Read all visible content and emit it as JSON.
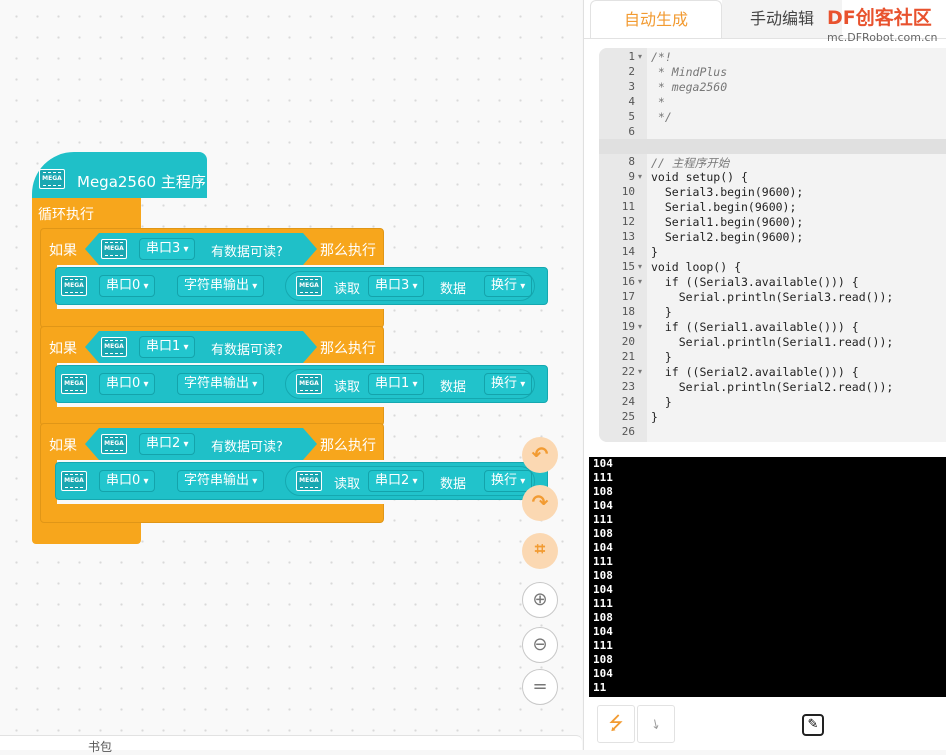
{
  "blocks": {
    "main_hat": "Mega2560 主程序",
    "loop_label": "循环执行",
    "mega_chip": "MEGA",
    "ifs": [
      {
        "if_label": "如果",
        "port": "串口3",
        "available": "有数据可读?",
        "then": "那么执行",
        "cmd_port": "串口0",
        "output_mode": "字符串输出",
        "read_label": "读取",
        "read_port": "串口3",
        "data_label": "数据",
        "newline": "换行"
      },
      {
        "if_label": "如果",
        "port": "串口1",
        "available": "有数据可读?",
        "then": "那么执行",
        "cmd_port": "串口0",
        "output_mode": "字符串输出",
        "read_label": "读取",
        "read_port": "串口1",
        "data_label": "数据",
        "newline": "换行"
      },
      {
        "if_label": "如果",
        "port": "串口2",
        "available": "有数据可读?",
        "then": "那么执行",
        "cmd_port": "串口0",
        "output_mode": "字符串输出",
        "read_label": "读取",
        "read_port": "串口2",
        "data_label": "数据",
        "newline": "换行"
      }
    ]
  },
  "backpack_label": "书包",
  "tabs": {
    "auto": "自动生成",
    "manual": "手动编辑"
  },
  "watermark": {
    "brand": "DF创客社区",
    "url": "mc.DFRobot.com.cn"
  },
  "code": {
    "line_numbers": [
      "1",
      "2",
      "3",
      "4",
      "5",
      "6",
      "7",
      "8",
      "9",
      "10",
      "11",
      "12",
      "13",
      "14",
      "15",
      "16",
      "17",
      "18",
      "19",
      "20",
      "21",
      "22",
      "23",
      "24",
      "25",
      "26"
    ],
    "lines": [
      "/*!",
      " * MindPlus",
      " * mega2560",
      " *",
      " */",
      "",
      "",
      "// 主程序开始",
      "void setup() {",
      "  Serial3.begin(9600);",
      "  Serial.begin(9600);",
      "  Serial1.begin(9600);",
      "  Serial2.begin(9600);",
      "}",
      "void loop() {",
      "  if ((Serial3.available())) {",
      "    Serial.println(Serial3.read());",
      "  }",
      "  if ((Serial1.available())) {",
      "    Serial.println(Serial1.read());",
      "  }",
      "  if ((Serial2.available())) {",
      "    Serial.println(Serial2.read());",
      "  }",
      "}",
      ""
    ]
  },
  "serial_output": [
    "104",
    "111",
    "108",
    "104",
    "111",
    "108",
    "104",
    "111",
    "108",
    "104",
    "111",
    "108",
    "104",
    "111",
    "108",
    "104",
    "11"
  ],
  "colors": {
    "accent": "#f29b32",
    "block_cyan": "#1fc0c8",
    "block_orange": "#f7a61c"
  }
}
